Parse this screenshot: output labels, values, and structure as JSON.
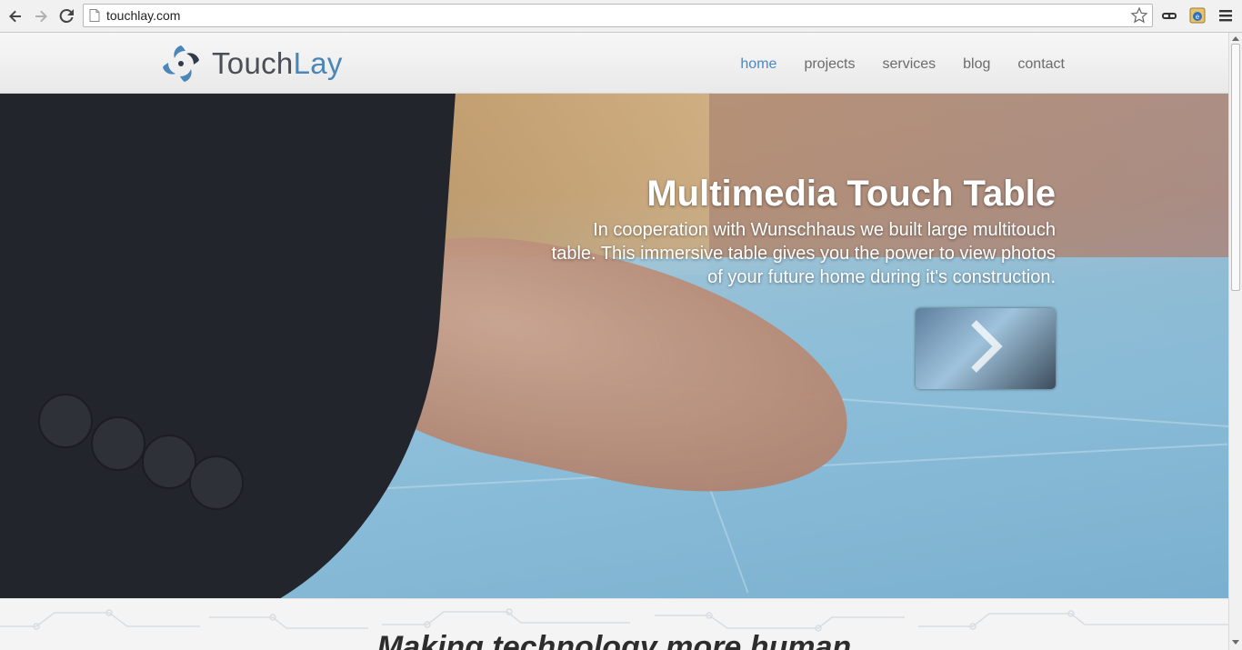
{
  "browser": {
    "url": "touchlay.com"
  },
  "site": {
    "brand_prefix": "Touch",
    "brand_suffix": "Lay",
    "nav": [
      {
        "label": "home",
        "active": true
      },
      {
        "label": "projects",
        "active": false
      },
      {
        "label": "services",
        "active": false
      },
      {
        "label": "blog",
        "active": false
      },
      {
        "label": "contact",
        "active": false
      }
    ]
  },
  "hero": {
    "title": "Multimedia Touch Table",
    "description": "In cooperation with Wunschhaus we built large multitouch table. This immersive table gives you the power to view photos of your future home during it's construction."
  },
  "section": {
    "heading": "Making technology more human"
  },
  "colors": {
    "nav_active": "#4b88c3",
    "brand_accent": "#4a86b8"
  }
}
